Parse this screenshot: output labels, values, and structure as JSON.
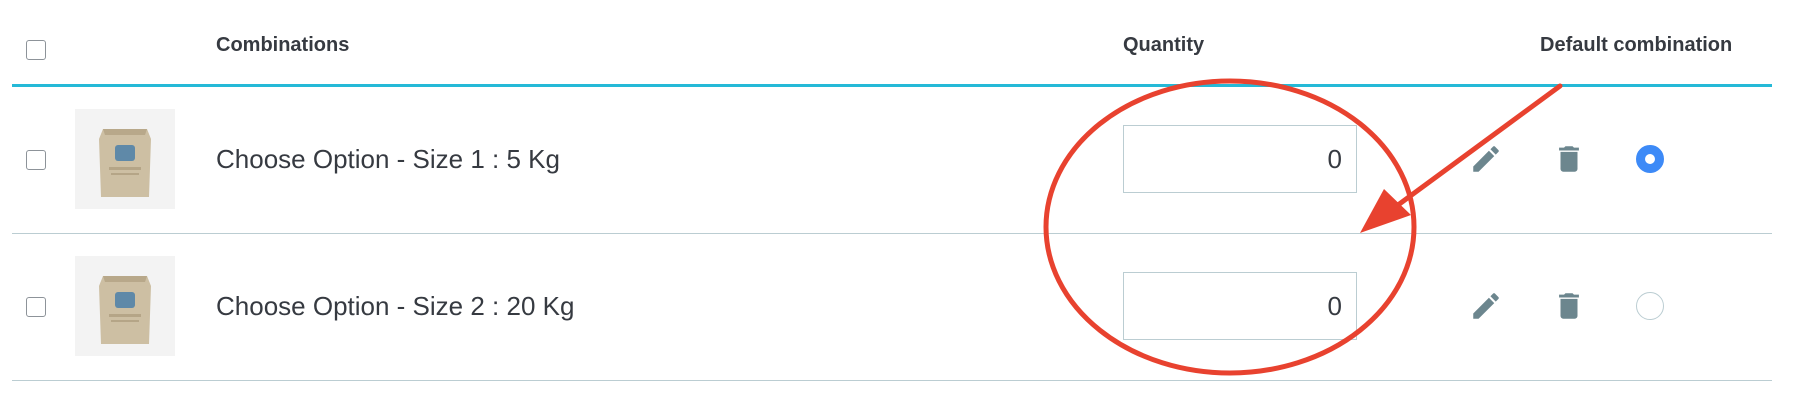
{
  "header": {
    "combinations_label": "Combinations",
    "quantity_label": "Quantity",
    "default_label": "Default combination"
  },
  "rows": [
    {
      "name": "Choose Option - Size 1 : 5 Kg",
      "quantity": "0",
      "default": true
    },
    {
      "name": "Choose Option - Size 2 : 20 Kg",
      "quantity": "0",
      "default": false
    }
  ],
  "colors": {
    "header_border": "#25b9d7",
    "radio_selected": "#3d8af7",
    "icon": "#6c868e",
    "annotation": "#e8422f"
  },
  "icons": {
    "edit": "pencil-icon",
    "delete": "trash-icon",
    "product_image": "product-bag-thumbnail"
  }
}
